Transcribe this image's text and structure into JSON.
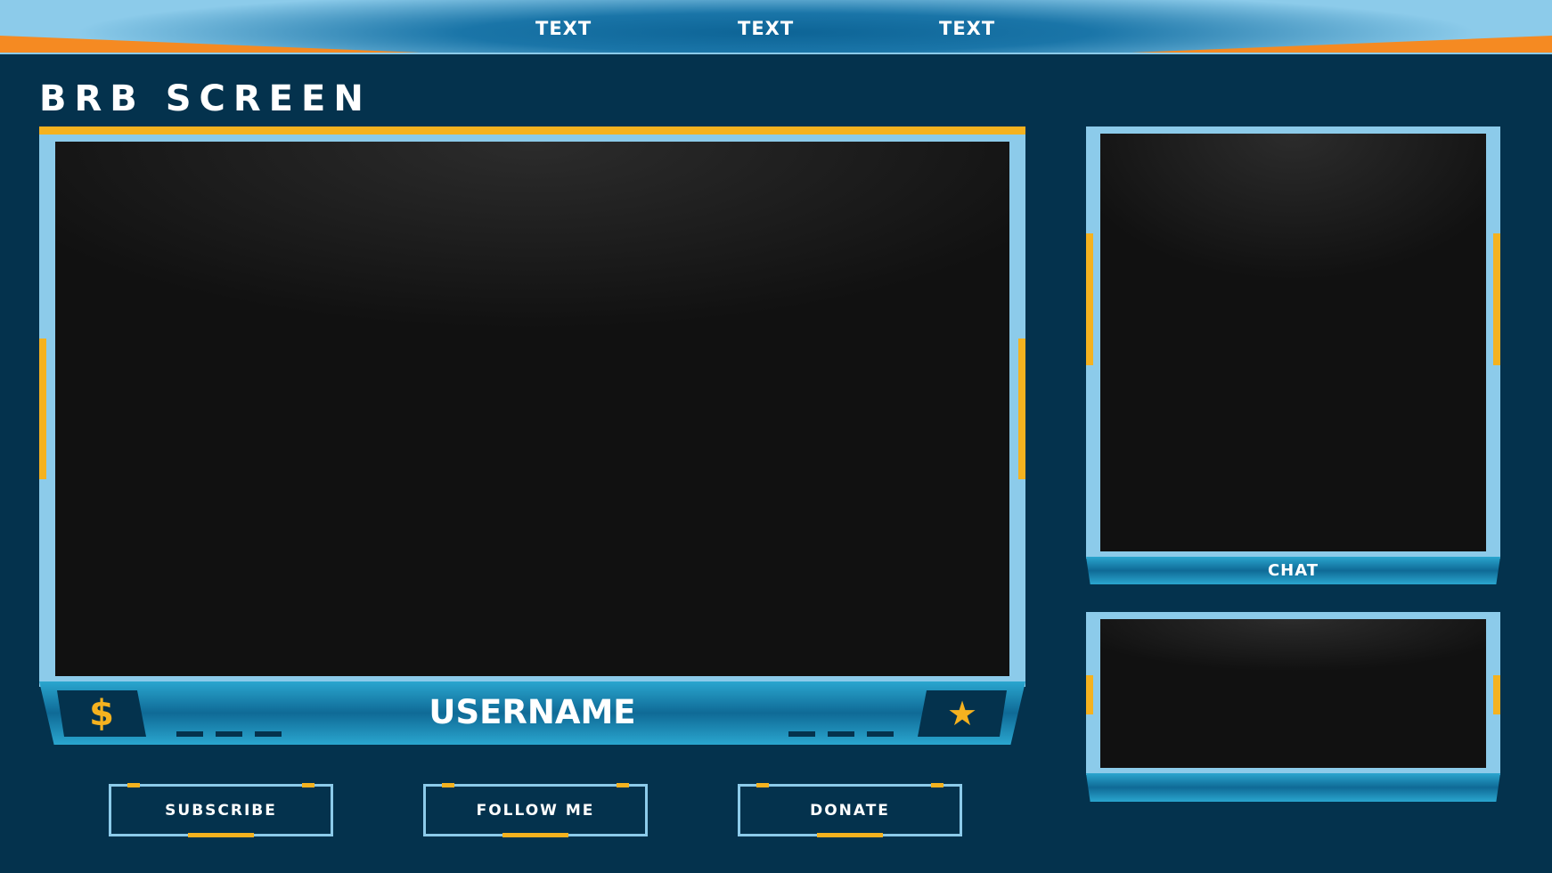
{
  "header": {
    "nav": [
      "TEXT",
      "TEXT",
      "TEXT"
    ]
  },
  "title": "BRB SCREEN",
  "main_panel": {
    "username": "USERNAME",
    "left_icon": "dollar-icon",
    "right_icon": "star-icon"
  },
  "buttons": [
    "SUBSCRIBE",
    "FOLLOW ME",
    "DONATE"
  ],
  "chat": {
    "label": "CHAT"
  },
  "colors": {
    "background": "#04324d",
    "frame": "#8ccbea",
    "accent_yellow": "#f5b21f",
    "accent_orange": "#f58a22",
    "bar_blue": "#2aa6cf"
  }
}
